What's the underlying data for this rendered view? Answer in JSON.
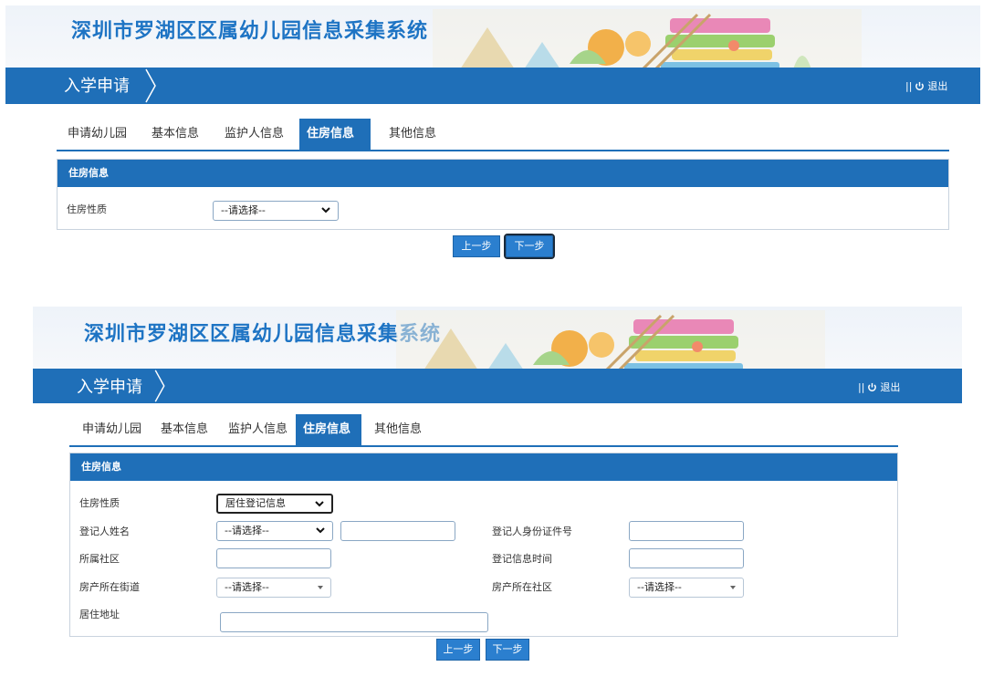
{
  "screens": [
    {
      "system_title": "深圳市罗湖区区属幼儿园信息采集系统",
      "nav_title": "入学申请",
      "logout_label": "退出",
      "tabs": [
        "申请幼儿园",
        "基本信息",
        "监护人信息",
        "住房信息",
        "其他信息"
      ],
      "active_tab": "住房信息",
      "panel_title": "住房信息",
      "fields": {
        "housing_type_label": "住房性质",
        "housing_type_value": "--请选择--"
      },
      "buttons": {
        "prev": "上一步",
        "next": "下一步"
      }
    },
    {
      "system_title": "深圳市罗湖区区属幼儿园信息采集系统",
      "nav_title": "入学申请",
      "logout_label": "退出",
      "tabs": [
        "申请幼儿园",
        "基本信息",
        "监护人信息",
        "住房信息",
        "其他信息"
      ],
      "active_tab": "住房信息",
      "panel_title": "住房信息",
      "fields": {
        "housing_type_label": "住房性质",
        "housing_type_value": "居住登记信息",
        "registrant_name_label": "登记人姓名",
        "registrant_name_select": "--请选择--",
        "registrant_id_label": "登记人身份证件号",
        "community_label": "所属社区",
        "register_time_label": "登记信息时间",
        "street_label": "房产所在街道",
        "street_value": "--请选择--",
        "property_community_label": "房产所在社区",
        "property_community_value": "--请选择--",
        "address_label": "居住地址"
      },
      "buttons": {
        "prev": "上一步",
        "next": "下一步"
      }
    }
  ],
  "colors": {
    "primary": "#1f6fb8",
    "title_blue": "#1e74c4",
    "button": "#2b7fcf"
  }
}
